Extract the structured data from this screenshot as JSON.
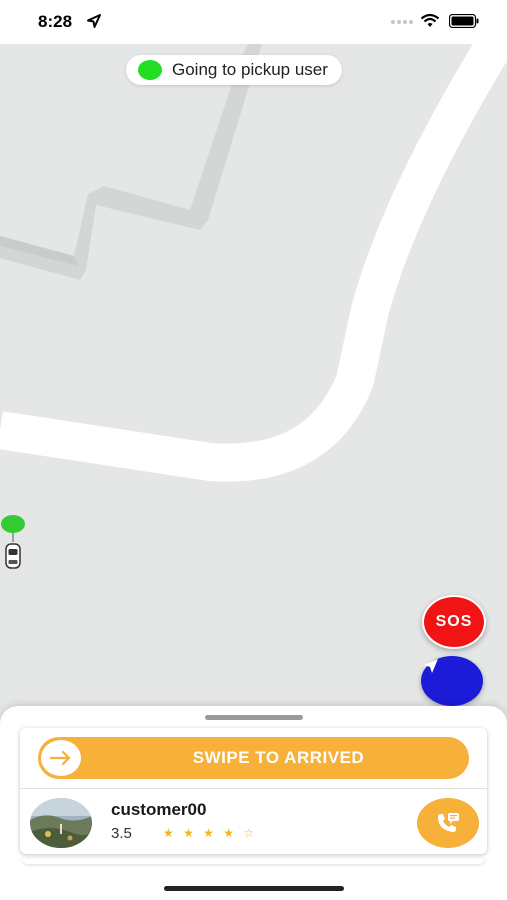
{
  "status_bar": {
    "time": "8:28"
  },
  "trip_status": {
    "text": "Going to pickup user",
    "dot_color": "#22dd22"
  },
  "sos_button": {
    "label": "SOS",
    "color": "#f01414"
  },
  "navigate_button": {
    "icon": "navigation-arrow-icon",
    "color": "#1b1bd8"
  },
  "bottom_sheet": {
    "swipe_button": {
      "label": "SWIPE TO ARRIVED",
      "color": "#f7b13a",
      "icon": "arrow-right-icon"
    },
    "customer": {
      "name": "customer00",
      "rating": "3.5",
      "stars": "★ ★ ★ ★ ☆"
    },
    "call_button": {
      "icon": "phone-chat-icon",
      "color": "#f7b13a"
    }
  }
}
